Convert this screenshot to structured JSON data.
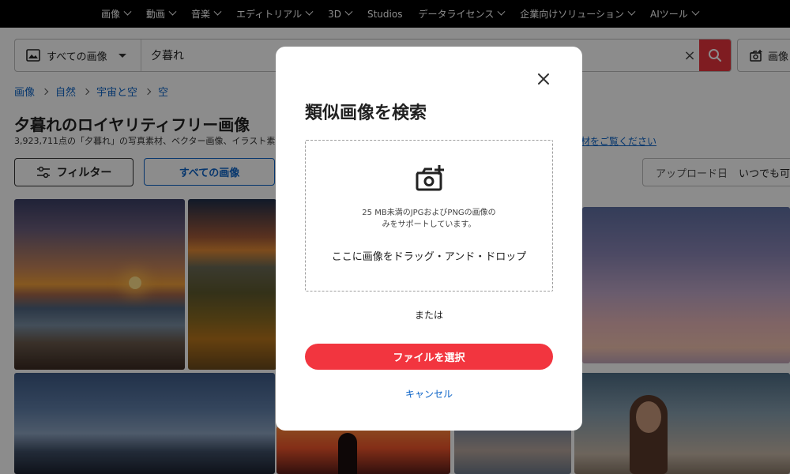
{
  "topnav": {
    "items": [
      {
        "label": "画像"
      },
      {
        "label": "動画"
      },
      {
        "label": "音楽"
      },
      {
        "label": "エディトリアル"
      },
      {
        "label": "3D"
      },
      {
        "label": "Studios"
      },
      {
        "label": "データライセンス"
      },
      {
        "label": "企業向けソリューション"
      },
      {
        "label": "AIツール"
      }
    ]
  },
  "search": {
    "scope_label": "すべての画像",
    "query": "夕暮れ",
    "image_search_label": "画像"
  },
  "breadcrumb": [
    "画像",
    "自然",
    "宇宙と空",
    "空"
  ],
  "page": {
    "title": "夕暮れのロイヤリティフリー画像",
    "result_count": "3,923,711点の「夕暮れ」の写真素材、ベクター画像、イラスト素",
    "bg_link": "材をご覧ください"
  },
  "filters": {
    "filter_label": "フィルター",
    "tab_all": "すべての画像",
    "upload_label": "アップロード日",
    "upload_value": "いつでも可"
  },
  "modal": {
    "title": "類似画像を検索",
    "hint_line1": "25 MB未満のJPGおよびPNGの画像の",
    "hint_line2": "みをサポートしています。",
    "drop_text": "ここに画像をドラッグ・アンド・ドロップ",
    "or_text": "または",
    "choose_label": "ファイルを選択",
    "cancel_label": "キャンセル"
  },
  "colors": {
    "accent_red": "#f2353f",
    "link_blue": "#0b63c7"
  }
}
